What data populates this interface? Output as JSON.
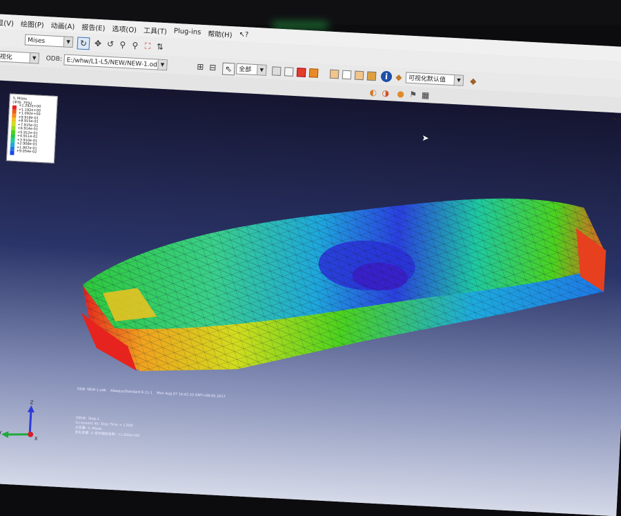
{
  "menu": [
    "显(V)",
    "绘图(P)",
    "动画(A)",
    "报告(E)",
    "选项(O)",
    "工具(T)",
    "Plug-ins",
    "帮助(H)"
  ],
  "toolbar": {
    "field_output": "Mises",
    "odb_label": "ODB:",
    "odb_path": "E:/whw/L1-L5/NEW/NEW-1.odb",
    "module": "可视化",
    "selection_scope": "全部",
    "render_style": "可视化默认值"
  },
  "legend": {
    "title": "S, Mises",
    "subtitle": "(平均: 75%)",
    "values": [
      "+1.292e+00",
      "+1.192e+00",
      "+1.092e+00",
      "+9.918e-01",
      "+8.915e-01",
      "+7.915e-01",
      "+6.914e-01",
      "+5.912e-01",
      "+4.911e-01",
      "+3.910e-01",
      "+2.908e-01",
      "+1.907e-01",
      "+9.054e-02"
    ],
    "colors": [
      "#e6231e",
      "#f05a1e",
      "#f58c1e",
      "#f0c31e",
      "#d2dc1e",
      "#96dc1e",
      "#4bd21e",
      "#1ec846",
      "#1ec8a0",
      "#1eaadc",
      "#1e78e6",
      "#1e46e6",
      "#2d1ed2"
    ]
  },
  "status": {
    "line1_a": "ODB: NEW-1.odb",
    "line1_b": "Abaqus/Standard 6.11-1",
    "line1_c": "Mon Aug 07 14:42:33 GMT+08:00 2017",
    "line2": "分析步: Step-1",
    "line3": "Increment   45: Step Time =   1.000",
    "line4": "主变量: S, Mises",
    "line5": "变形变量: U   变形缩放系数: +1.000e+00"
  },
  "axes": {
    "x": "X",
    "y": "Y",
    "z": "Z"
  },
  "colors": {
    "viewport_top": "#151530",
    "viewport_bottom": "#d8dcea"
  }
}
